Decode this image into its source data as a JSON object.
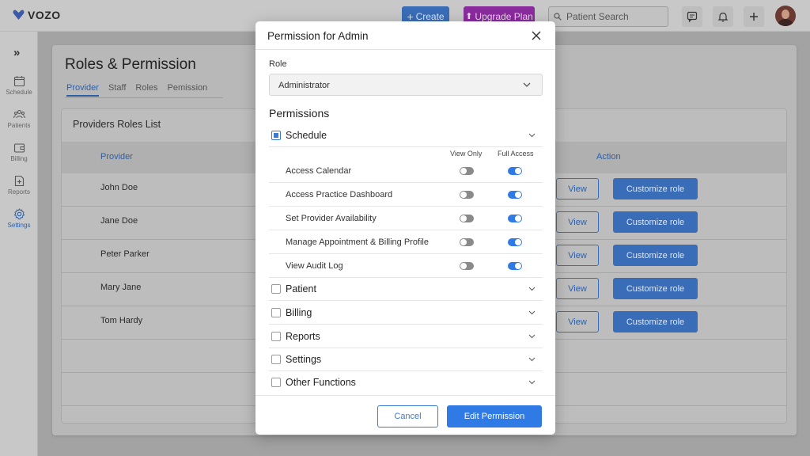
{
  "app": {
    "logo": "VOZO"
  },
  "topbar": {
    "create_label": "Create",
    "upgrade_label": "Upgrade Plan",
    "search_placeholder": "Patient Search"
  },
  "sidebar": {
    "items": [
      {
        "label": "Schedule",
        "icon": "calendar-icon"
      },
      {
        "label": "Patients",
        "icon": "users-icon"
      },
      {
        "label": "Billing",
        "icon": "wallet-icon"
      },
      {
        "label": "Reports",
        "icon": "report-icon"
      },
      {
        "label": "Settings",
        "icon": "gear-icon"
      }
    ]
  },
  "page": {
    "title": "Roles & Permission",
    "tabs": [
      "Provider",
      "Staff",
      "Roles",
      "Pemission"
    ],
    "list_title": "Providers Roles List",
    "columns": {
      "provider": "Provider",
      "action": "Action"
    },
    "rows": [
      {
        "name": "John Doe"
      },
      {
        "name": "Jane Doe"
      },
      {
        "name": "Peter Parker"
      },
      {
        "name": "Mary Jane"
      },
      {
        "name": "Tom Hardy"
      }
    ],
    "view_label": "View",
    "customize_label": "Customize role"
  },
  "modal": {
    "title": "Permission for Admin",
    "role_label": "Role",
    "role_value": "Administrator",
    "permissions_title": "Permissions",
    "col_view_only": "View Only",
    "col_full_access": "Full Access",
    "schedule_label": "Schedule",
    "schedule_items": [
      "Access Calendar",
      "Access Practice Dashboard",
      "Set Provider Availability",
      "Manage Appointment & Billing Profile",
      "View Audit Log"
    ],
    "other_sections": [
      "Patient",
      "Billing",
      "Reports",
      "Settings",
      "Other Functions"
    ],
    "cancel_label": "Cancel",
    "submit_label": "Edit Permission"
  },
  "colors": {
    "primary": "#2f7ae5",
    "upgrade": "#a11fbf"
  }
}
